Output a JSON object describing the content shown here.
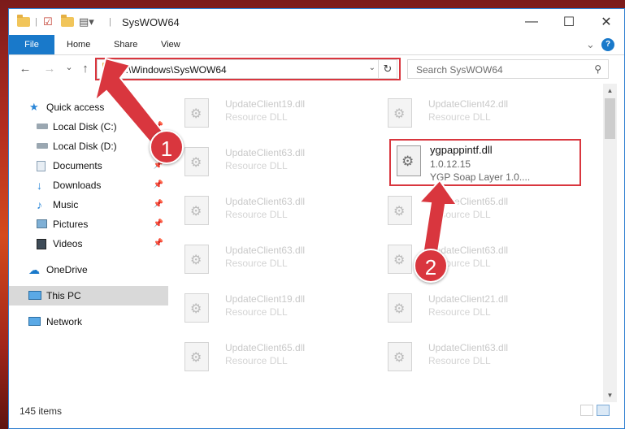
{
  "window": {
    "title": "SysWOW64",
    "minimize": "—",
    "maximize": "☐",
    "close": "✕",
    "help": "?"
  },
  "ribbon": {
    "tabs": [
      "File",
      "Home",
      "Share",
      "View"
    ],
    "chevron": "⌄"
  },
  "address": {
    "path": "C:\\Windows\\SysWOW64",
    "dropdown": "⌄",
    "refresh": "↻"
  },
  "search": {
    "placeholder": "Search SysWOW64",
    "icon": "⚲"
  },
  "nav": {
    "back": "←",
    "forward": "→",
    "recent": "⌄",
    "up": "↑"
  },
  "sidebar": {
    "items": [
      {
        "label": "Quick access",
        "icon": "star-icon",
        "pinned": false
      },
      {
        "label": "Local Disk (C:)",
        "icon": "drive-icon",
        "pinned": true
      },
      {
        "label": "Local Disk (D:)",
        "icon": "drive-icon",
        "pinned": true
      },
      {
        "label": "Documents",
        "icon": "documents-icon",
        "pinned": true
      },
      {
        "label": "Downloads",
        "icon": "download-icon",
        "pinned": true
      },
      {
        "label": "Music",
        "icon": "music-icon",
        "pinned": true
      },
      {
        "label": "Pictures",
        "icon": "pictures-icon",
        "pinned": true
      },
      {
        "label": "Videos",
        "icon": "videos-icon",
        "pinned": true
      },
      {
        "label": "OneDrive",
        "icon": "cloud-icon",
        "pinned": false
      },
      {
        "label": "This PC",
        "icon": "computer-icon",
        "pinned": false,
        "selected": true
      },
      {
        "label": "Network",
        "icon": "network-icon",
        "pinned": false
      }
    ],
    "pin_glyph": "📌"
  },
  "files": [
    {
      "name": "UpdateClient19.dll",
      "type": "Resource DLL"
    },
    {
      "name": "UpdateClient42.dll",
      "type": "Resource DLL"
    },
    {
      "name": "UpdateClient63.dll",
      "type": "Resource DLL"
    },
    {
      "name": "UpdateClient63.dll",
      "type": "Resource DLL"
    },
    {
      "name": "UpdateClient65.dll",
      "type": "Resource DLL"
    },
    {
      "name": "UpdateClient63.dll",
      "type": "Resource DLL"
    },
    {
      "name": "UpdateClient63.dll",
      "type": "Resource DLL"
    },
    {
      "name": "UpdateClient19.dll",
      "type": "Resource DLL"
    },
    {
      "name": "UpdateClient21.dll",
      "type": "Resource DLL"
    },
    {
      "name": "UpdateClient65.dll",
      "type": "Resource DLL"
    },
    {
      "name": "UpdateClient63.dll",
      "type": "Resource DLL"
    }
  ],
  "highlighted_file": {
    "name": "ygpappintf.dll",
    "version": "1.0.12.15",
    "description": "YGP Soap Layer 1.0...."
  },
  "status": {
    "items": "145 items"
  },
  "callouts": [
    "1",
    "2"
  ],
  "colors": {
    "accent": "#1979ca",
    "highlight": "#d9363e"
  }
}
